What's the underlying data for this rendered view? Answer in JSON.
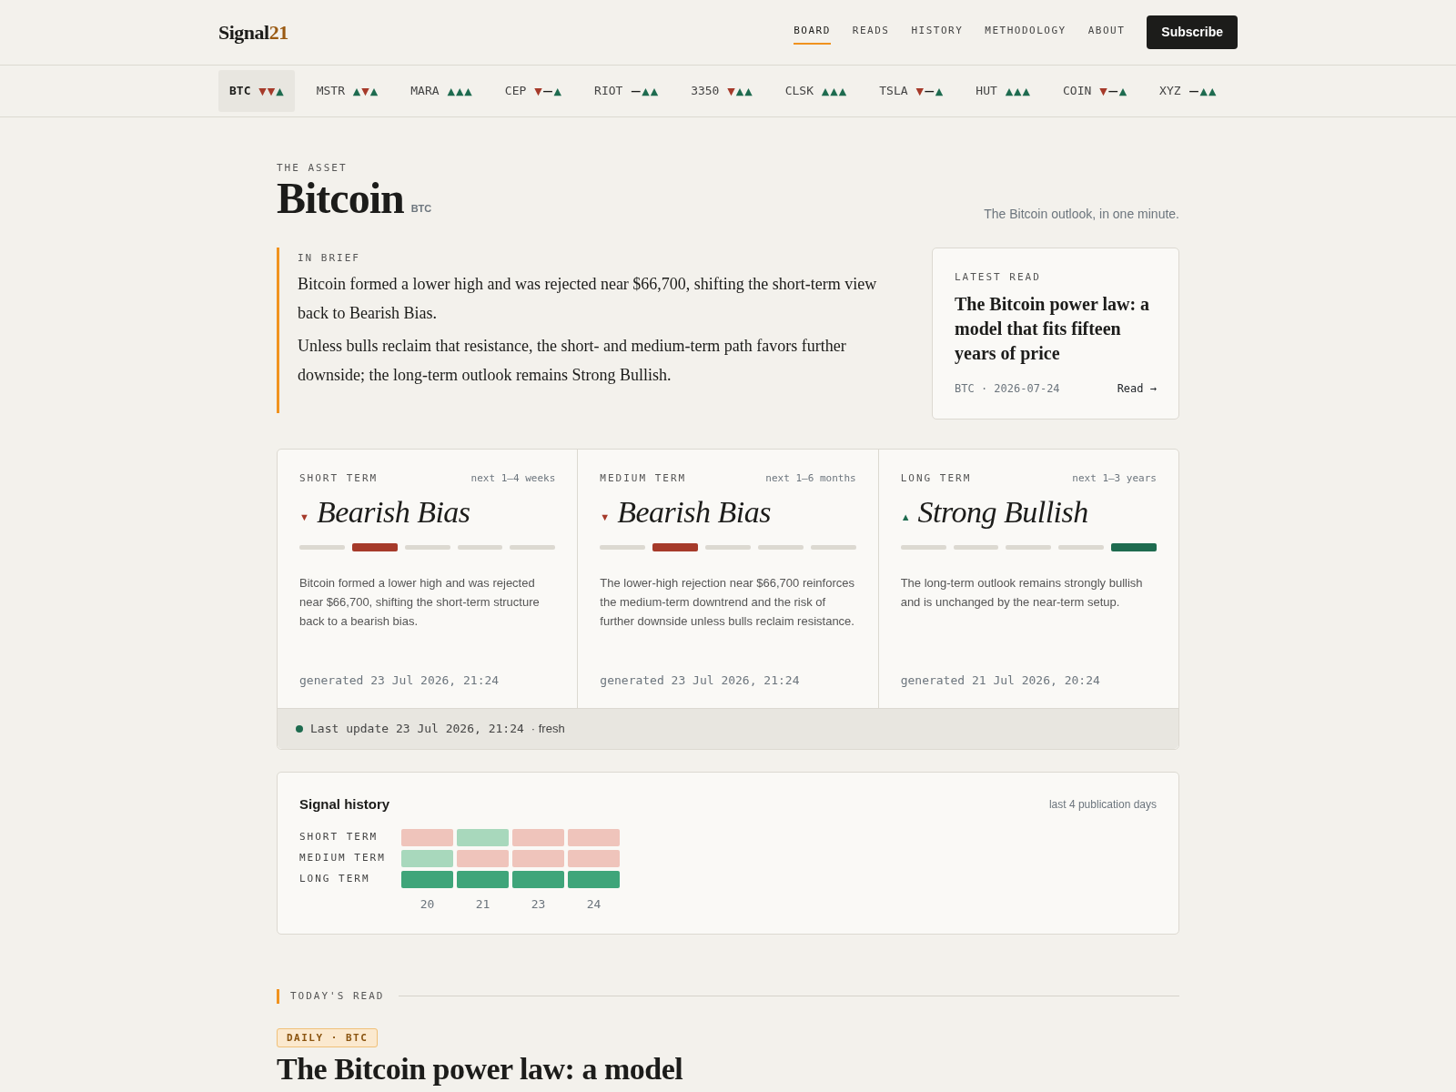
{
  "logo": {
    "text": "Signal",
    "accent": "21"
  },
  "nav": [
    {
      "label": "BOARD",
      "selected": true
    },
    {
      "label": "READS",
      "selected": false
    },
    {
      "label": "HISTORY",
      "selected": false
    },
    {
      "label": "METHODOLOGY",
      "selected": false
    },
    {
      "label": "ABOUT",
      "selected": false
    }
  ],
  "subscribe_button": "Subscribe",
  "tickers": [
    {
      "symbol": "BTC",
      "selected": true,
      "signals": [
        {
          "glyph": "▼",
          "color": "#a63a2a"
        },
        {
          "glyph": "▼",
          "color": "#a63a2a"
        },
        {
          "glyph": "▲",
          "color": "#1e6b4f"
        }
      ]
    },
    {
      "symbol": "MSTR",
      "selected": false,
      "signals": [
        {
          "glyph": "▲",
          "color": "#1e6b4f"
        },
        {
          "glyph": "▼",
          "color": "#a63a2a"
        },
        {
          "glyph": "▲",
          "color": "#1e6b4f"
        }
      ]
    },
    {
      "symbol": "MARA",
      "selected": false,
      "signals": [
        {
          "glyph": "▲",
          "color": "#1e6b4f"
        },
        {
          "glyph": "▲",
          "color": "#1e6b4f"
        },
        {
          "glyph": "▲",
          "color": "#1e6b4f"
        }
      ]
    },
    {
      "symbol": "CEP",
      "selected": false,
      "signals": [
        {
          "glyph": "▼",
          "color": "#a63a2a"
        },
        {
          "glyph": "—",
          "color": "#1c1c1a"
        },
        {
          "glyph": "▲",
          "color": "#1e6b4f"
        }
      ]
    },
    {
      "symbol": "RIOT",
      "selected": false,
      "signals": [
        {
          "glyph": "—",
          "color": "#1c1c1a"
        },
        {
          "glyph": "▲",
          "color": "#1e6b4f"
        },
        {
          "glyph": "▲",
          "color": "#1e6b4f"
        }
      ]
    },
    {
      "symbol": "3350",
      "selected": false,
      "signals": [
        {
          "glyph": "▼",
          "color": "#a63a2a"
        },
        {
          "glyph": "▲",
          "color": "#1e6b4f"
        },
        {
          "glyph": "▲",
          "color": "#1e6b4f"
        }
      ]
    },
    {
      "symbol": "CLSK",
      "selected": false,
      "signals": [
        {
          "glyph": "▲",
          "color": "#1e6b4f"
        },
        {
          "glyph": "▲",
          "color": "#1e6b4f"
        },
        {
          "glyph": "▲",
          "color": "#1e6b4f"
        }
      ]
    },
    {
      "symbol": "TSLA",
      "selected": false,
      "signals": [
        {
          "glyph": "▼",
          "color": "#a63a2a"
        },
        {
          "glyph": "—",
          "color": "#1c1c1a"
        },
        {
          "glyph": "▲",
          "color": "#1e6b4f"
        }
      ]
    },
    {
      "symbol": "HUT",
      "selected": false,
      "signals": [
        {
          "glyph": "▲",
          "color": "#1e6b4f"
        },
        {
          "glyph": "▲",
          "color": "#1e6b4f"
        },
        {
          "glyph": "▲",
          "color": "#1e6b4f"
        }
      ]
    },
    {
      "symbol": "COIN",
      "selected": false,
      "signals": [
        {
          "glyph": "▼",
          "color": "#a63a2a"
        },
        {
          "glyph": "—",
          "color": "#1c1c1a"
        },
        {
          "glyph": "▲",
          "color": "#1e6b4f"
        }
      ]
    },
    {
      "symbol": "XYZ",
      "selected": false,
      "signals": [
        {
          "glyph": "—",
          "color": "#1c1c1a"
        },
        {
          "glyph": "▲",
          "color": "#1e6b4f"
        },
        {
          "glyph": "▲",
          "color": "#1e6b4f"
        }
      ]
    }
  ],
  "asset": {
    "eyebrow": "THE ASSET",
    "name": "Bitcoin",
    "symbol": "BTC",
    "tagline": "The Bitcoin outlook, in one minute."
  },
  "brief": {
    "label": "IN BRIEF",
    "paragraphs": [
      "Bitcoin formed a lower high and was rejected near $66,700, shifting the short-term view back to Bearish Bias.",
      "Unless bulls reclaim that resistance, the short- and medium-term path favors further downside; the long-term outlook remains Strong Bullish."
    ]
  },
  "latest_read": {
    "label": "LATEST READ",
    "title": "The Bitcoin power law: a model that fits fifteen years of price",
    "meta": "BTC · 2026-07-24",
    "link": "Read →"
  },
  "horizons": [
    {
      "label": "SHORT TERM",
      "window": "next 1–4 weeks",
      "arrow": "▼",
      "color": "#a63a2a",
      "verdict": "Bearish Bias",
      "segments": [
        {
          "on": false
        },
        {
          "on": true
        },
        {
          "on": false
        },
        {
          "on": false
        },
        {
          "on": false
        }
      ],
      "text": "Bitcoin formed a lower high and was rejected near $66,700, shifting the short-term structure back to a bearish bias.",
      "generated": "generated 23 Jul 2026, 21:24"
    },
    {
      "label": "MEDIUM TERM",
      "window": "next 1–6 months",
      "arrow": "▼",
      "color": "#a63a2a",
      "verdict": "Bearish Bias",
      "segments": [
        {
          "on": false
        },
        {
          "on": true
        },
        {
          "on": false
        },
        {
          "on": false
        },
        {
          "on": false
        }
      ],
      "text": "The lower-high rejection near $66,700 reinforces the medium-term downtrend and the risk of further downside unless bulls reclaim resistance.",
      "generated": "generated 23 Jul 2026, 21:24"
    },
    {
      "label": "LONG TERM",
      "window": "next 1–3 years",
      "arrow": "▲",
      "color": "#1e6b4f",
      "verdict": "Strong Bullish",
      "segments": [
        {
          "on": false
        },
        {
          "on": false
        },
        {
          "on": false
        },
        {
          "on": false
        },
        {
          "on": true
        }
      ],
      "text": "The long-term outlook remains strongly bullish and is unchanged by the near-term setup.",
      "generated": "generated 21 Jul 2026, 20:24"
    }
  ],
  "status": {
    "fresh": true,
    "text": "Last update 23 Jul 2026, 21:24",
    "note": "· fresh"
  },
  "history": {
    "title": "Signal history",
    "note": "last 4 publication days",
    "days": [
      "20",
      "21",
      "23",
      "24"
    ],
    "rows": [
      {
        "label": "SHORT TERM",
        "cells": [
          {
            "color": "#efc4bb"
          },
          {
            "color": "#a8d8bc"
          },
          {
            "color": "#efc4bb"
          },
          {
            "color": "#efc4bb"
          }
        ]
      },
      {
        "label": "MEDIUM TERM",
        "cells": [
          {
            "color": "#a8d8bc"
          },
          {
            "color": "#efc4bb"
          },
          {
            "color": "#efc4bb"
          },
          {
            "color": "#efc4bb"
          }
        ]
      },
      {
        "label": "LONG TERM",
        "cells": [
          {
            "color": "#3fa57a"
          },
          {
            "color": "#3fa57a"
          },
          {
            "color": "#3fa57a"
          },
          {
            "color": "#3fa57a"
          }
        ]
      }
    ]
  },
  "todays_read": {
    "label": "TODAY'S READ",
    "tag": "DAILY · BTC",
    "title": "The Bitcoin power law: a model"
  }
}
